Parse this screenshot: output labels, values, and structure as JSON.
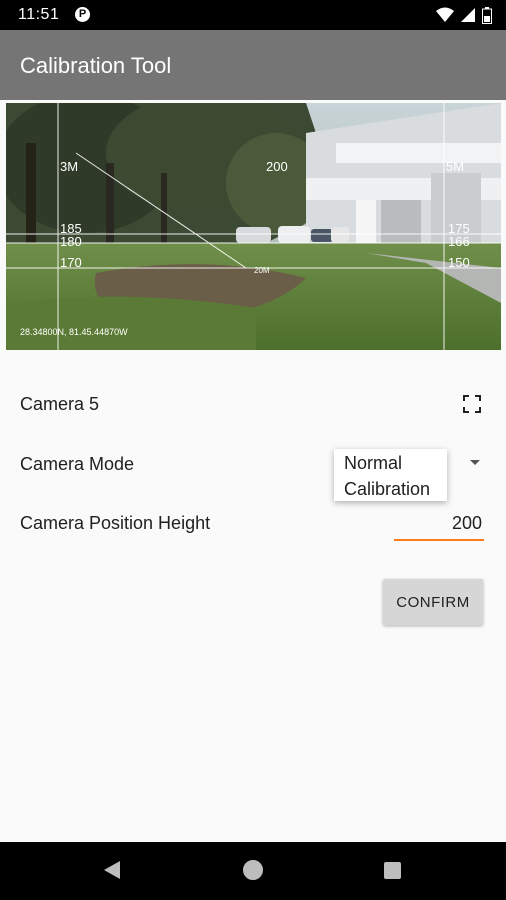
{
  "status_bar": {
    "time": "11:51",
    "notification_icon": "parking-p-icon",
    "icons": [
      "wifi-icon",
      "signal-icon",
      "battery-icon"
    ]
  },
  "app_bar": {
    "title": "Calibration Tool"
  },
  "camera_view": {
    "overlay_labels": {
      "left_distance": "3M",
      "center_distance": "200",
      "right_distance": "5M",
      "left_upper": "185",
      "left_middle": "180",
      "left_lower": "170",
      "right_upper": "175",
      "right_middle": "166",
      "right_lower": "150",
      "ground_mark": "20M",
      "coordinates": "28.34800N, 81.45.44870W"
    }
  },
  "settings": {
    "camera_name": "Camera 5",
    "fullscreen_icon": "fullscreen-icon",
    "camera_mode_label": "Camera Mode",
    "camera_mode_options": [
      "Normal",
      "Calibration"
    ],
    "position_height_label": "Camera Position Height",
    "position_height_value": "200",
    "confirm_label": "CONFIRM"
  },
  "nav_bar": {
    "icons": [
      "back-icon",
      "home-icon",
      "recent-apps-icon"
    ]
  },
  "colors": {
    "app_bar": "#757575",
    "accent": "#ff7a1a",
    "button": "#d6d6d6"
  }
}
